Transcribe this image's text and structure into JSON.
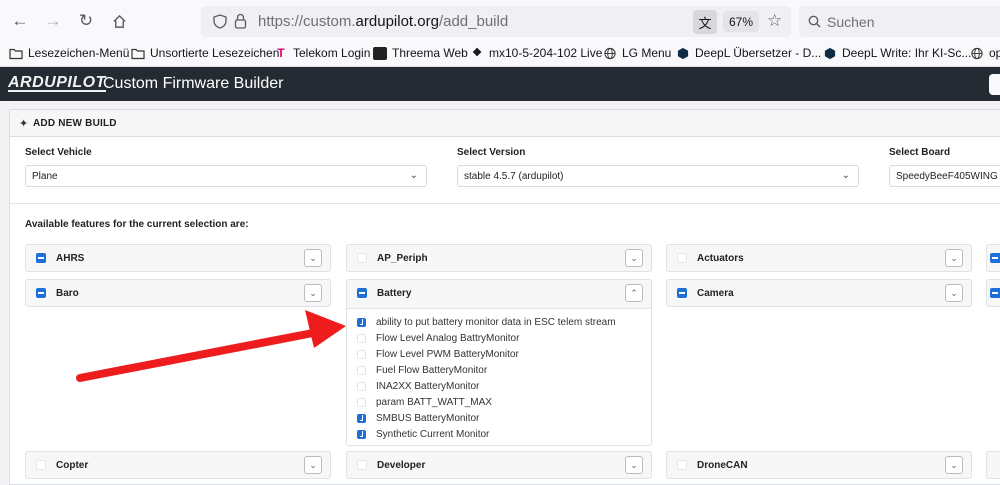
{
  "browser": {
    "url_prefix": "https://custom.",
    "url_domain": "ardupilot.org",
    "url_path": "/add_build",
    "zoom": "67%",
    "search_placeholder": "Suchen",
    "bookmarks": [
      {
        "label": "Lesezeichen-Menü",
        "icon": "folder-icon"
      },
      {
        "label": "Unsortierte Lesezeichen",
        "icon": "folder-icon"
      },
      {
        "label": "Telekom Login",
        "icon": "telekom-icon"
      },
      {
        "label": "Threema Web",
        "icon": "threema-icon"
      },
      {
        "label": "mx10-5-204-102 Live",
        "icon": "mx-icon"
      },
      {
        "label": "LG Menu",
        "icon": "globe-icon"
      },
      {
        "label": "DeepL Übersetzer - D...",
        "icon": "deepl-icon"
      },
      {
        "label": "DeepL Write: Ihr KI-Sc...",
        "icon": "deepl-icon"
      },
      {
        "label": "op",
        "icon": "globe-icon"
      }
    ]
  },
  "app": {
    "logo": "ARDUPILOT",
    "title": "Custom Firmware Builder"
  },
  "panel": {
    "title": "ADD NEW BUILD",
    "vehicle_label": "Select Vehicle",
    "vehicle_value": "Plane",
    "version_label": "Select Version",
    "version_value": "stable 4.5.7 (ardupilot)",
    "board_label": "Select Board",
    "board_value": "SpeedyBeeF405WING",
    "available_label": "Available features for the current selection are:"
  },
  "features": [
    {
      "name": "AHRS",
      "checked": "partial"
    },
    {
      "name": "AP_Periph",
      "checked": "none"
    },
    {
      "name": "Actuators",
      "checked": "none"
    },
    {
      "name": "Baro",
      "checked": "partial"
    },
    {
      "name": "Battery",
      "checked": "partial",
      "expanded": true
    },
    {
      "name": "Camera",
      "checked": "partial"
    },
    {
      "name": "Copter",
      "checked": "none"
    },
    {
      "name": "Developer",
      "checked": "none"
    },
    {
      "name": "DroneCAN",
      "checked": "none"
    }
  ],
  "battery_options": [
    {
      "label": "ability to put battery monitor data in ESC telem stream",
      "checked": true
    },
    {
      "label": "Flow Level Analog BattryMonitor",
      "checked": false
    },
    {
      "label": "Flow Level PWM BatteryMonitor",
      "checked": false
    },
    {
      "label": "Fuel Flow BatteryMonitor",
      "checked": false
    },
    {
      "label": "INA2XX BatteryMonitor",
      "checked": false
    },
    {
      "label": "param BATT_WATT_MAX",
      "checked": false
    },
    {
      "label": "SMBUS BatteryMonitor",
      "checked": true
    },
    {
      "label": "Synthetic Current Monitor",
      "checked": true
    }
  ],
  "colors": {
    "header_bg": "#242b33",
    "checkbox_blue": "#1f6fd8",
    "arrow_red": "#ee1c1c"
  }
}
